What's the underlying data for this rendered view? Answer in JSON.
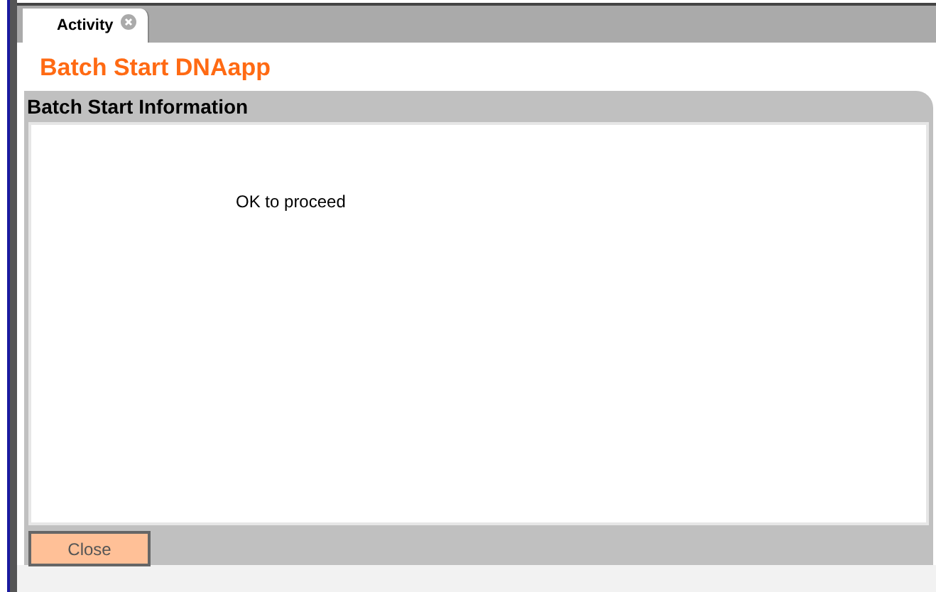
{
  "tabs": [
    {
      "label": "Activity",
      "selected": true
    }
  ],
  "page_title": "Batch Start DNAapp",
  "panel": {
    "title": "Batch Start Information",
    "message": "OK to proceed"
  },
  "buttons": [
    {
      "label": "Close"
    }
  ]
}
